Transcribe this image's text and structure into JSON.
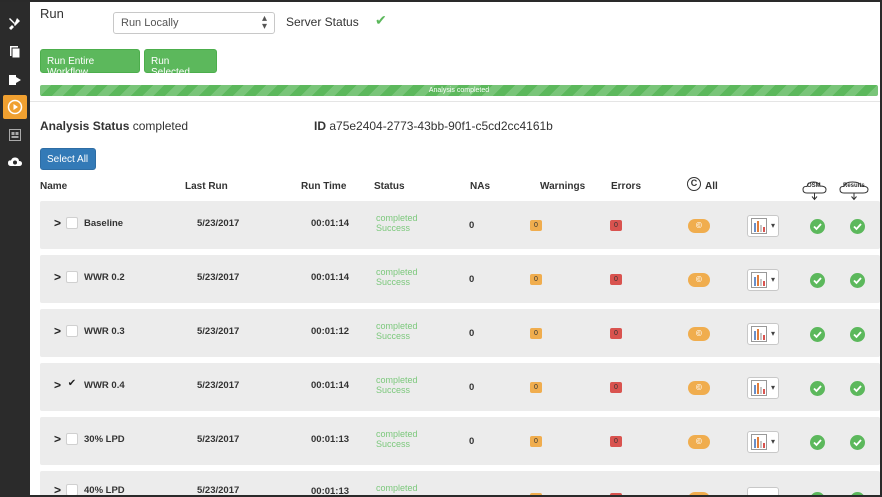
{
  "run": {
    "label": "Run",
    "mode_selected": "Run Locally",
    "server_status_label": "Server Status"
  },
  "buttons": {
    "run_entire_workflow": "Run Entire Workflow",
    "run_selected": "Run Selected",
    "select_all": "Select All"
  },
  "progress": {
    "text": "Analysis completed",
    "fraction": 1.0
  },
  "analysis": {
    "status_label": "Analysis Status",
    "status_value": "completed",
    "id_label": "ID",
    "id_value": "a75e2404-2773-43bb-90f1-c5cd2cc4161b"
  },
  "table": {
    "headers": {
      "name": "Name",
      "last_run": "Last Run",
      "run_time": "Run Time",
      "status": "Status",
      "nas": "NAs",
      "warnings": "Warnings",
      "errors": "Errors",
      "all": "All",
      "osm": "OSM",
      "results": "Results"
    },
    "rows": [
      {
        "name": "Baseline",
        "last_run": "5/23/2017",
        "run_time": "00:01:14",
        "status": "completed",
        "substatus": "Success",
        "nas": "0",
        "warnings": "0",
        "errors": "0",
        "checked": false
      },
      {
        "name": "WWR 0.2",
        "last_run": "5/23/2017",
        "run_time": "00:01:14",
        "status": "completed",
        "substatus": "Success",
        "nas": "0",
        "warnings": "0",
        "errors": "0",
        "checked": false
      },
      {
        "name": "WWR 0.3",
        "last_run": "5/23/2017",
        "run_time": "00:01:12",
        "status": "completed",
        "substatus": "Success",
        "nas": "0",
        "warnings": "0",
        "errors": "0",
        "checked": false
      },
      {
        "name": "WWR 0.4",
        "last_run": "5/23/2017",
        "run_time": "00:01:14",
        "status": "completed",
        "substatus": "Success",
        "nas": "0",
        "warnings": "0",
        "errors": "0",
        "checked": true
      },
      {
        "name": "30% LPD",
        "last_run": "5/23/2017",
        "run_time": "00:01:13",
        "status": "completed",
        "substatus": "Success",
        "nas": "0",
        "warnings": "0",
        "errors": "0",
        "checked": false
      },
      {
        "name": "40% LPD",
        "last_run": "5/23/2017",
        "run_time": "00:01:13",
        "status": "completed",
        "substatus": "",
        "nas": "",
        "warnings": "",
        "errors": "",
        "checked": false
      }
    ]
  },
  "icons": {
    "server_status": "check-icon",
    "row_expand": "chevron-right-icon",
    "copy_badge": "copyright-icon",
    "chart_menu": "bar-chart-icon",
    "ok_status": "check-circle-icon",
    "osm_download": "cloud-download-icon",
    "results_download": "cloud-download-icon"
  },
  "colors": {
    "sidebar": "#2b2b2b",
    "sidebar_active": "#f0a030",
    "success": "#5cb85c",
    "primary": "#337ab7",
    "warning": "#f0ad4e",
    "danger": "#d9534f",
    "row_bg": "#ececec"
  }
}
